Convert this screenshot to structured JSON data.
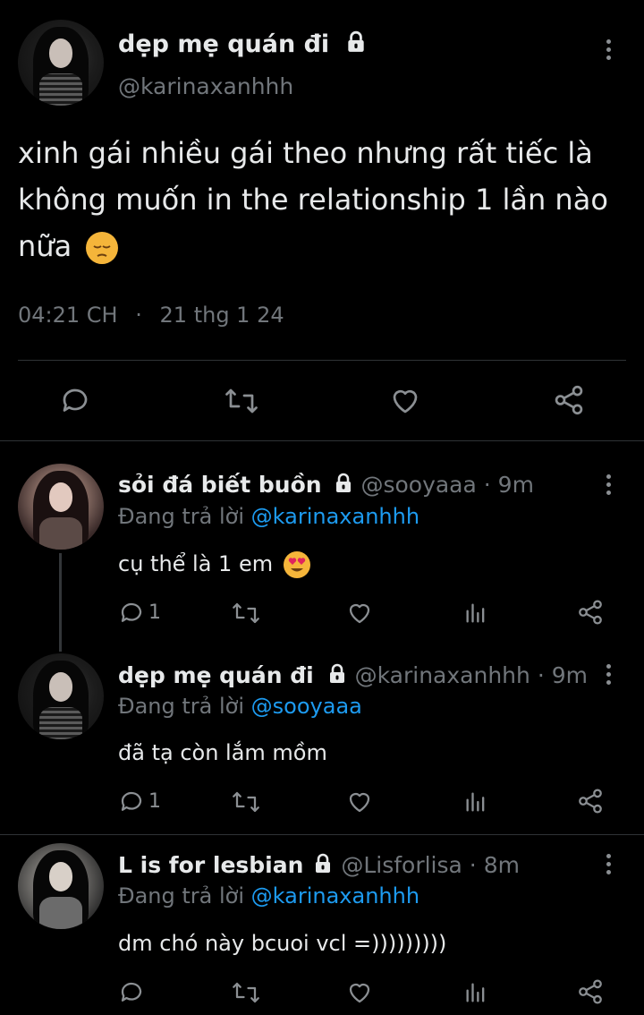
{
  "tweet": {
    "display_name": "dẹp mẹ quán đi",
    "handle": "@karinaxanhhh",
    "text_line1": "xinh gái nhiều gái theo nhưng rất tiếc là",
    "text_line2": "không muốn in the relationship 1 lần nào",
    "text_line3": "nữa",
    "emoji": "pensive-face",
    "time": "04:21 CH",
    "dot": "·",
    "date": "21 thg 1 24"
  },
  "replies": [
    {
      "display_name": "sỏi đá biết buồn",
      "handle": "@sooyaaa",
      "age": "· 9m",
      "reply_prefix": "Đang trả lời",
      "reply_mention": "@karinaxanhhh",
      "text": "cụ thể là 1 em",
      "emoji": "heart-eyes-face",
      "reply_count": "1"
    },
    {
      "display_name": "dẹp mẹ quán đi",
      "handle": "@karinaxanhhh",
      "age": "· 9m",
      "reply_prefix": "Đang trả lời",
      "reply_mention": "@sooyaaa",
      "text": "đã tạ còn lắm mồm",
      "reply_count": "1"
    },
    {
      "display_name": "L is for lesbian",
      "handle": "@Lisforlisa",
      "age": "· 8m",
      "reply_prefix": "Đang trả lời",
      "reply_mention": "@karinaxanhhh",
      "text": "dm chó này bcuoi vcl =)))))))))",
      "reply_count": ""
    }
  ],
  "colors": {
    "background": "#000000",
    "text": "#e7e9ea",
    "secondary": "#71767b",
    "link": "#1d9bf0",
    "divider": "#2f3336"
  }
}
